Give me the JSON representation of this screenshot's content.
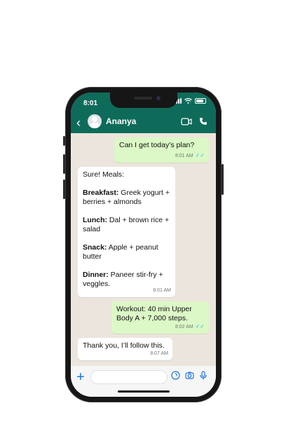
{
  "status_bar": {
    "time": "8:01"
  },
  "header": {
    "contact_name": "Ananya"
  },
  "messages": [
    {
      "from": "me",
      "text": "Can I get today’s plan?",
      "time": "8:01 AM",
      "read": true
    },
    {
      "from": "contact",
      "lines": [
        {
          "bold": "",
          "text": "Sure! Meals:"
        },
        {
          "bold": "Breakfast:",
          "text": " Greek yogurt + berries + almonds"
        },
        {
          "bold": "Lunch:",
          "text": " Dal + brown rice + salad"
        },
        {
          "bold": "Snack:",
          "text": " Apple + peanut butter"
        },
        {
          "bold": "Dinner:",
          "text": " Paneer stir-fry + veggles."
        }
      ],
      "time": "8:01 AM"
    },
    {
      "from": "me",
      "text": "Workout: 40 min Upper Body A + 7,000 steps.",
      "time": "8:02 AM",
      "read": true
    },
    {
      "from": "contact",
      "text": "Thank you, I’ll follow this.",
      "time": "8:07 AM"
    }
  ],
  "colors": {
    "header": "#0E6B5A",
    "chat_bg": "#ECE5DD",
    "outgoing": "#DCF8C6",
    "incoming": "#FFFFFF",
    "read_tick": "#34B7F1"
  },
  "icons": [
    "back-arrow-icon",
    "avatar",
    "video-call-icon",
    "phone-icon",
    "plus-icon",
    "sticker-icon",
    "camera-icon",
    "microphone-icon"
  ]
}
